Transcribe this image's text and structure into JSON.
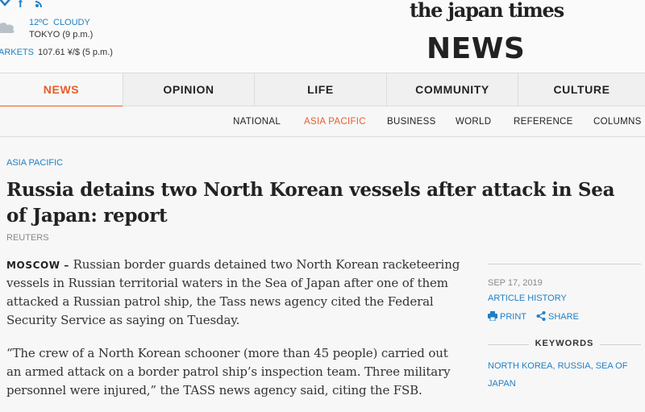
{
  "header": {
    "social": [
      {
        "name": "twitter",
        "glyph": "✓"
      },
      {
        "name": "facebook",
        "glyph": "f"
      },
      {
        "name": "rss",
        "glyph": "⌘"
      }
    ],
    "weather": {
      "temperature": "12ºC",
      "condition": "CLOUDY",
      "location": "TOKYO (9 p.m.)",
      "icon": "cloud-icon"
    },
    "markets": {
      "label": "ARKETS",
      "value": "107.61 ¥/$ (5 p.m.)"
    },
    "brand": "the japan times",
    "section": "NEWS"
  },
  "nav": {
    "items": [
      {
        "label": "NEWS",
        "active": true
      },
      {
        "label": "OPINION",
        "active": false
      },
      {
        "label": "LIFE",
        "active": false
      },
      {
        "label": "COMMUNITY",
        "active": false
      },
      {
        "label": "CULTURE",
        "active": false
      }
    ]
  },
  "subnav": {
    "items": [
      {
        "label": "NATIONAL",
        "active": false
      },
      {
        "label": "ASIA PACIFIC",
        "active": true
      },
      {
        "label": "BUSINESS",
        "active": false
      },
      {
        "label": "WORLD",
        "active": false
      },
      {
        "label": "REFERENCE",
        "active": false
      },
      {
        "label": "COLUMNS",
        "active": false
      }
    ]
  },
  "article": {
    "kicker": "ASIA PACIFIC",
    "headline": "Russia detains two North Korean vessels after attack in Sea of Japan: report",
    "byline": "REUTERS",
    "dateline": "MOSCOW –",
    "paragraph1": " Russian border guards detained two North Korean racketeering vessels in Russian territorial waters in the Sea of Japan after one of them attacked a Russian patrol ship, the Tass news agency cited the Federal Security Service as saying on Tuesday.",
    "paragraph2": "“The crew of a North Korean schooner (more than 45 people) carried out an armed attack on a border patrol ship’s inspection team. Three military personnel were injured,” the TASS news agency said, citing the FSB."
  },
  "sidebar": {
    "date": "SEP 17, 2019",
    "history_label": "ARTICLE HISTORY",
    "print_label": "PRINT",
    "share_label": "SHARE",
    "keywords_heading": "KEYWORDS",
    "keywords": [
      "NORTH KOREA",
      "RUSSIA",
      "SEA OF JAPAN"
    ],
    "keyword_separator": ", "
  },
  "colors": {
    "accent": "#e85d29",
    "link": "#1f7fc6",
    "text": "#222222"
  }
}
